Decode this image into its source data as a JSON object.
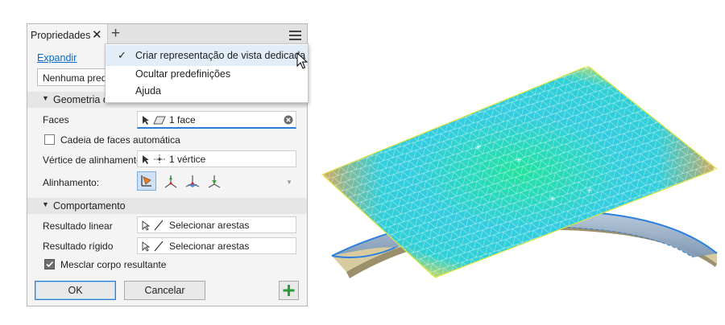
{
  "panel": {
    "tab_title": "Propriedades",
    "close_glyph": "✕",
    "add_glyph": "+",
    "expand_link": "Expandir",
    "preset_value": "Nenhuma prede",
    "sections": {
      "input": "Geometria de entrada",
      "behavior": "Comportamento"
    },
    "faces": {
      "label": "Faces",
      "value": "1 face"
    },
    "auto_chain": {
      "label": "Cadeia de faces automática",
      "checked": false
    },
    "align_vertex": {
      "label": "Vértice de alinhamento",
      "value": "1 vértice"
    },
    "alignment": {
      "label": "Alinhamento:"
    },
    "linear_result": {
      "label": "Resultado linear",
      "value": "Selecionar arestas"
    },
    "rigid_result": {
      "label": "Resultado rígido",
      "value": "Selecionar arestas"
    },
    "merge_body": {
      "label": "Mesclar corpo resultante",
      "checked": true
    },
    "buttons": {
      "ok": "OK",
      "cancel": "Cancelar",
      "add": "+"
    }
  },
  "menu": {
    "check_glyph": "✓",
    "items": [
      {
        "label": "Criar representação de vista dedicada",
        "checked": true
      },
      {
        "label": "Ocultar predefinições"
      },
      {
        "label": "Ajuda"
      }
    ]
  },
  "colors": {
    "accent": "#0969c8",
    "add_button": "#2e9b3a",
    "menu_highlight": "#e3edf7"
  },
  "icons": [
    "close-icon",
    "add-tab-icon",
    "hamburger-menu-icon",
    "checkmark-icon",
    "mouse-pointer-icon",
    "select-arrow-icon",
    "face-icon",
    "vertex-icon",
    "edge-icon",
    "clear-icon",
    "align-icon",
    "plus-icon"
  ]
}
